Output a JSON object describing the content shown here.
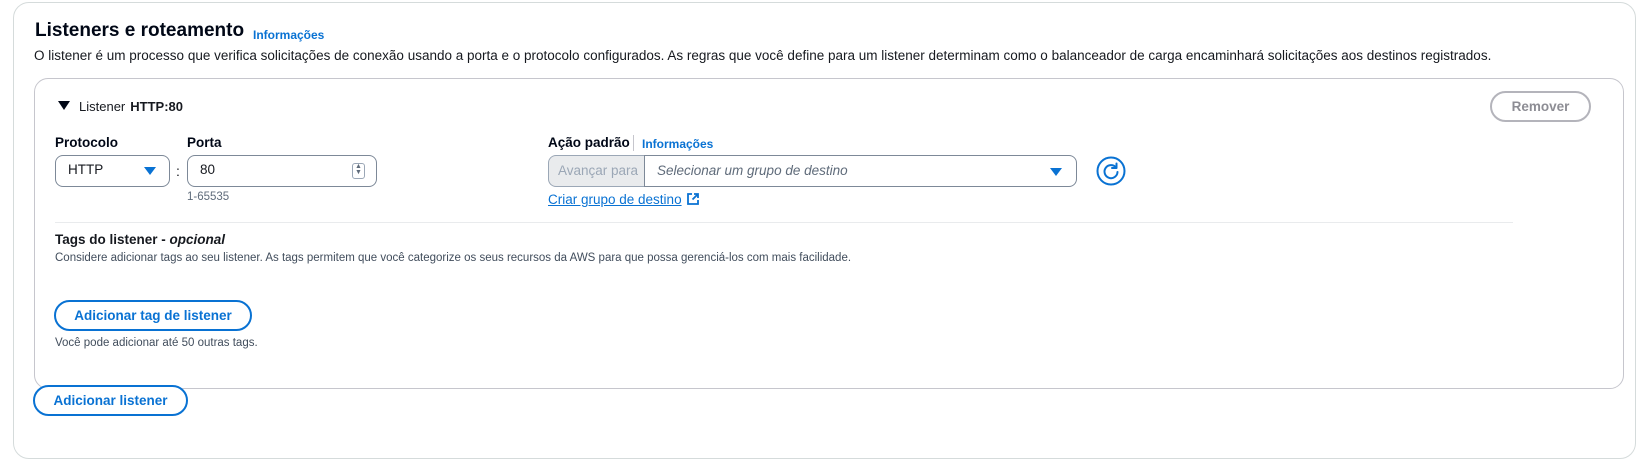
{
  "section": {
    "title": "Listeners e roteamento",
    "info_link": "Informações",
    "description": "O listener é um processo que verifica solicitações de conexão usando a porta e o protocolo configurados. As regras que você define para um listener determinam como o balanceador de carga encaminhará solicitações aos destinos registrados."
  },
  "listener": {
    "label": "Listener",
    "name": "HTTP:80",
    "remove_button": "Remover",
    "protocol_label": "Protocolo",
    "protocol_value": "HTTP",
    "port_label": "Porta",
    "port_separator": ":",
    "port_value": "80",
    "port_hint": "1-65535",
    "default_action_label": "Ação padrão",
    "default_action_info": "Informações",
    "action_prefix": "Avançar para",
    "target_group_placeholder": "Selecionar um grupo de destino",
    "create_target_group_link": "Criar grupo de destino",
    "tags": {
      "title": "Tags do listener - ",
      "optional": "opcional",
      "description": "Considere adicionar tags ao seu listener. As tags permitem que você categorize os seus recursos da AWS para que possa gerenciá-los com mais facilidade.",
      "add_button": "Adicionar tag de listener",
      "limit_hint": "Você pode adicionar até 50 outras tags."
    }
  },
  "add_listener_button": "Adicionar listener",
  "colors": {
    "accent": "#0972d3",
    "text": "#16191f",
    "border": "#7d8998",
    "disabled": "#9ba7b6"
  },
  "icons": {
    "collapse": "caret-down-icon",
    "dropdown": "chevron-down-icon",
    "refresh": "refresh-icon",
    "external": "external-link-icon"
  }
}
